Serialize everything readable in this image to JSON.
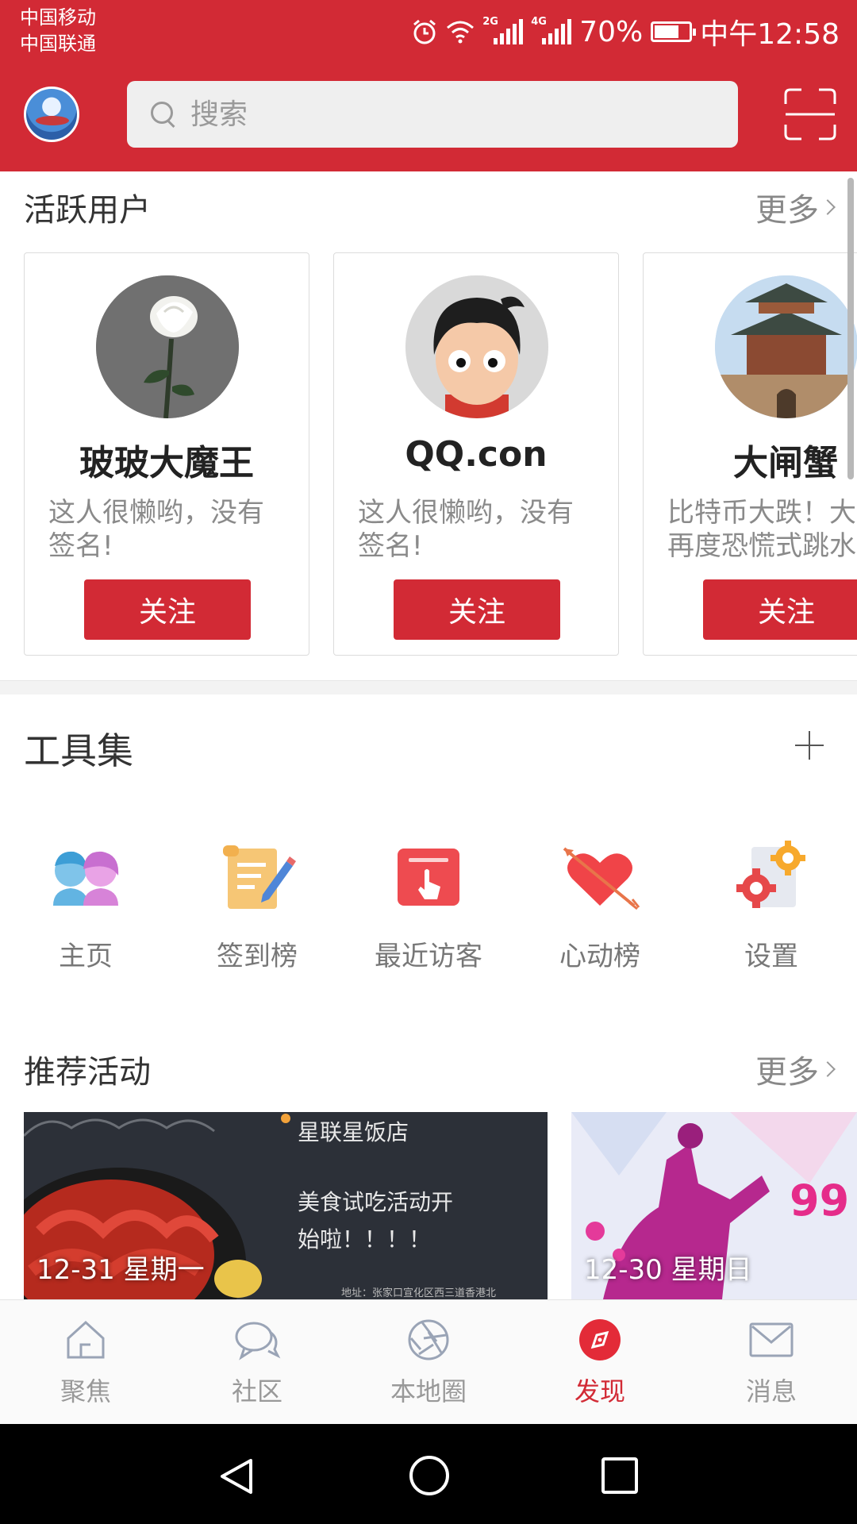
{
  "status_bar": {
    "carrier_1": "中国移动",
    "carrier_2": "中国联通",
    "net_1": "2G",
    "net_2": "4G",
    "battery": "70%",
    "battery_level": 0.7,
    "time": "中午12:58"
  },
  "header": {
    "search_placeholder": "搜索"
  },
  "active_users": {
    "title": "活跃用户",
    "more": "更多",
    "users": [
      {
        "name": "玻玻大魔王",
        "sig_line1": "这人很懒哟，没有",
        "sig_line2": "签名!",
        "button": "关注"
      },
      {
        "name": "QQ.con",
        "sig_line1": "这人很懒哟，没有",
        "sig_line2": "签名!",
        "button": "关注"
      },
      {
        "name": "大闸蟹",
        "sig_line1": "比特币大跌！大",
        "sig_line2": "再度恐慌式跳水",
        "button": "关注"
      }
    ]
  },
  "tools": {
    "title": "工具集",
    "items": [
      {
        "label": "主页",
        "icon": "homepage-icon"
      },
      {
        "label": "签到榜",
        "icon": "checkin-ranking-icon"
      },
      {
        "label": "最近访客",
        "icon": "recent-visitors-icon"
      },
      {
        "label": "心动榜",
        "icon": "heart-ranking-icon"
      },
      {
        "label": "设置",
        "icon": "settings-icon"
      }
    ]
  },
  "activities": {
    "title": "推荐活动",
    "more": "更多",
    "items": [
      {
        "date": "12-31 星期一",
        "poster_title": "星联星饭店",
        "poster_line1": "美食试吃活动开",
        "poster_line2": "始啦！！！！",
        "poster_footer": "地址：张家口宣化区西三道香港北"
      },
      {
        "date": "12-30 星期日",
        "poster_badge": "99"
      }
    ]
  },
  "bottom_nav": {
    "items": [
      {
        "label": "聚焦",
        "icon": "home-icon"
      },
      {
        "label": "社区",
        "icon": "chat-icon"
      },
      {
        "label": "本地圈",
        "icon": "aperture-icon"
      },
      {
        "label": "发现",
        "icon": "compass-icon",
        "active": true
      },
      {
        "label": "消息",
        "icon": "mail-icon"
      }
    ]
  },
  "colors": {
    "brand_red": "#d22a35",
    "inactive_gray": "#999999"
  }
}
